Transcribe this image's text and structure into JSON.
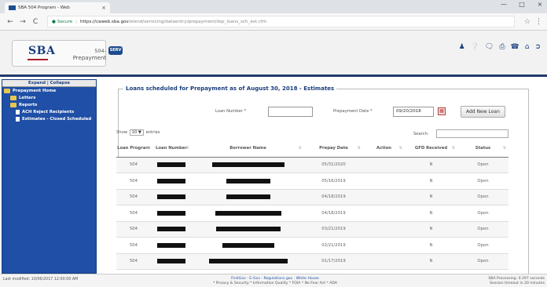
{
  "browser": {
    "tab_title": "SBA 504 Program - Web",
    "tab_close": "×",
    "win_min": "—",
    "win_max": "□",
    "win_close": "×",
    "back": "←",
    "forward": "→",
    "reload": "C",
    "secure_label": "Secure",
    "url_base": "https://caweb.sba.gov",
    "url_path": "/elend/servicing/dataentry/prepayment/dsp_loans_sch_est.cfm",
    "star": "☆",
    "menu": "⋮"
  },
  "header": {
    "logo_text": "SBA",
    "app_name_line1": "504-",
    "app_name_line2": "Prepayment",
    "env_badge": "SERV",
    "icons": [
      "user-icon",
      "help-icon",
      "chat-icon",
      "print-icon",
      "phone-icon",
      "home-icon",
      "logout-icon"
    ]
  },
  "sidebar": {
    "expand": "Expand",
    "separator": "|",
    "collapse": "Collapse",
    "items": [
      {
        "label": "Prepayment Home",
        "icon": "folder-icon",
        "level": 0
      },
      {
        "label": "Letters",
        "icon": "folder-icon",
        "level": 1
      },
      {
        "label": "Reports",
        "icon": "folder-icon",
        "level": 1
      },
      {
        "label": "ACH Reject Recipients",
        "icon": "page-icon",
        "level": 2
      },
      {
        "label": "Estimates - Closed Scheduled",
        "icon": "page-icon",
        "level": 2
      }
    ]
  },
  "main": {
    "title": "Loans scheduled for Prepayment as of August 30, 2018 - Estimates",
    "loan_number_label": "Loan Number *",
    "loan_number_value": "",
    "prepay_date_label": "Prepayment Date *",
    "prepay_date_value": "09/20/2018",
    "calendar_glyph": "▦",
    "add_button": "Add New Loan",
    "show_label": "Show",
    "show_value": "10",
    "show_arrow": "▼",
    "entries_label": "entries",
    "search_label": "Search:"
  },
  "table": {
    "sort_glyph": "⇅",
    "columns": [
      "Loan Program",
      "Loan Number",
      "Borrower Name",
      "Prepay Date",
      "Action",
      "GFD Received",
      "Status"
    ],
    "rows": [
      {
        "program": "504",
        "prepay_date": "05/31/2020",
        "gfd": "N",
        "status": "Open"
      },
      {
        "program": "504",
        "prepay_date": "05/16/2019",
        "gfd": "N",
        "status": "Open"
      },
      {
        "program": "504",
        "prepay_date": "04/18/2019",
        "gfd": "N",
        "status": "Open"
      },
      {
        "program": "504",
        "prepay_date": "04/18/2019",
        "gfd": "N",
        "status": "Open"
      },
      {
        "program": "504",
        "prepay_date": "03/21/2019",
        "gfd": "N",
        "status": "Open"
      },
      {
        "program": "504",
        "prepay_date": "02/21/2019",
        "gfd": "N",
        "status": "Open"
      },
      {
        "program": "504",
        "prepay_date": "01/17/2019",
        "gfd": "N",
        "status": "Open"
      },
      {
        "program": "504",
        "prepay_date": "01/17/2019",
        "gfd": "N",
        "status": "Open"
      }
    ]
  },
  "footer": {
    "last_modified": "Last modified: 10/06/2017 12:00:00 AM",
    "links": "FirstGov  ·  E-Gov  ·  Regulations.gov  ·  White House",
    "policies": "* Privacy & Security  * Information Quality  * FOIA  * No Fear Act  * ADA",
    "processing": "SBA Processing: 0.297 seconds",
    "session": "Session timeout in 20 minutes"
  }
}
